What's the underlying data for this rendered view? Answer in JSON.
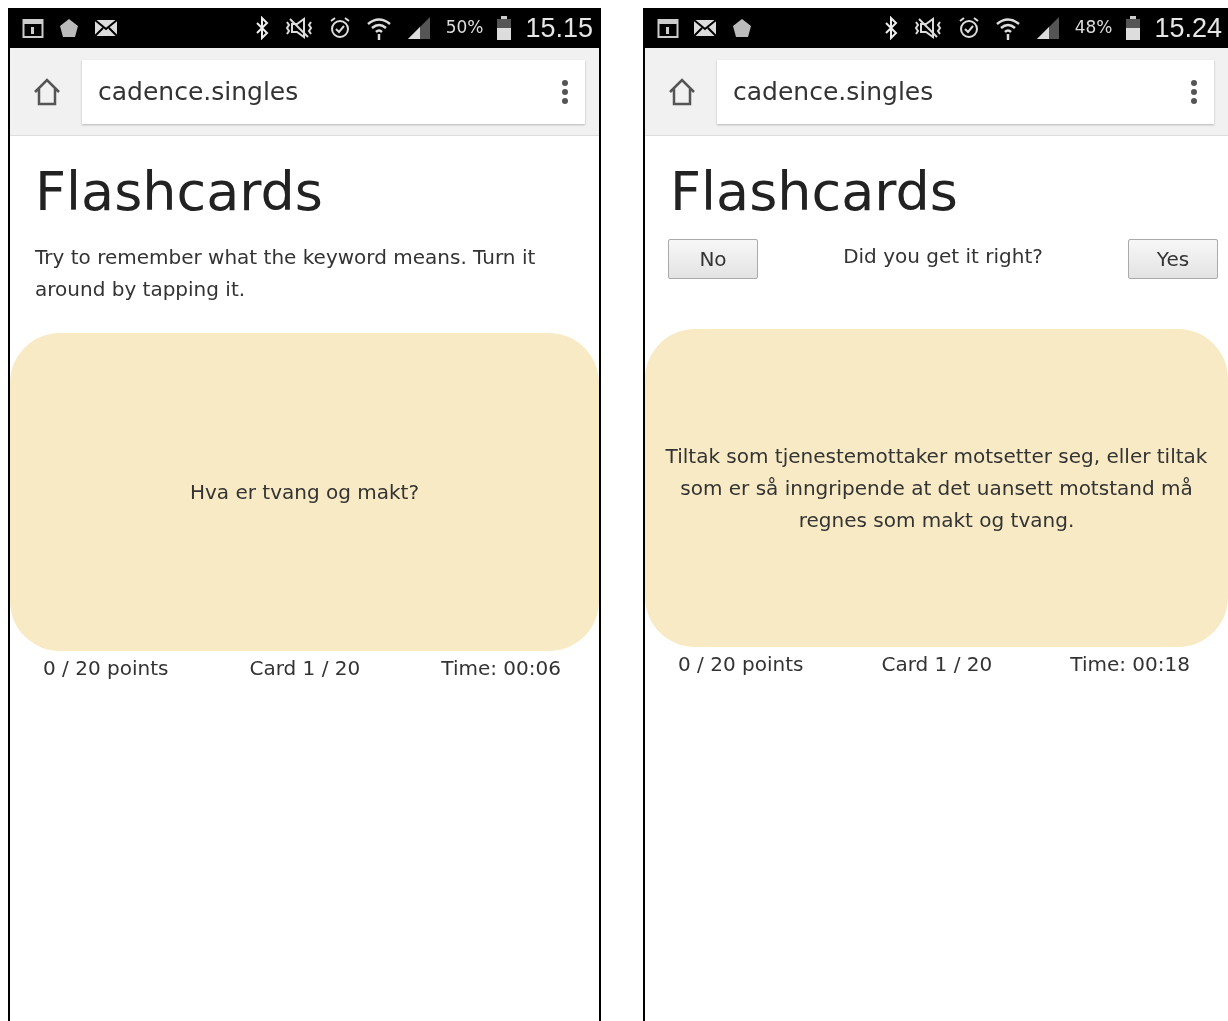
{
  "screens": [
    {
      "kind": "question",
      "status_bar": {
        "notification_icons": [
          {
            "kind": "calendar"
          },
          {
            "kind": "gem"
          },
          {
            "kind": "mail"
          }
        ],
        "battery": "50%",
        "time": "15.15"
      },
      "address": "cadence.singles",
      "title": "Flashcards",
      "instructions": "Try to remember what the keyword means. Turn it around by tapping it.",
      "card_text": "Hva er tvang og makt?",
      "footer": {
        "points": "0 / 20 points",
        "card": "Card 1 / 20",
        "time": "Time: 00:06"
      }
    },
    {
      "kind": "answer",
      "status_bar": {
        "notification_icons": [
          {
            "kind": "calendar"
          },
          {
            "kind": "mail"
          },
          {
            "kind": "gem"
          }
        ],
        "battery": "48%",
        "time": "15.24"
      },
      "address": "cadence.singles",
      "title": "Flashcards",
      "prompt": "Did you get it right?",
      "buttons": [
        "No",
        "Yes"
      ],
      "card_text": "Tiltak som tjenestemottaker motsetter seg, eller tiltak som er så inngripende at det uansett motstand må regnes som makt og tvang.",
      "footer": {
        "points": "0 / 20 points",
        "card": "Card 1 / 20",
        "time": "Time: 00:18"
      }
    }
  ]
}
